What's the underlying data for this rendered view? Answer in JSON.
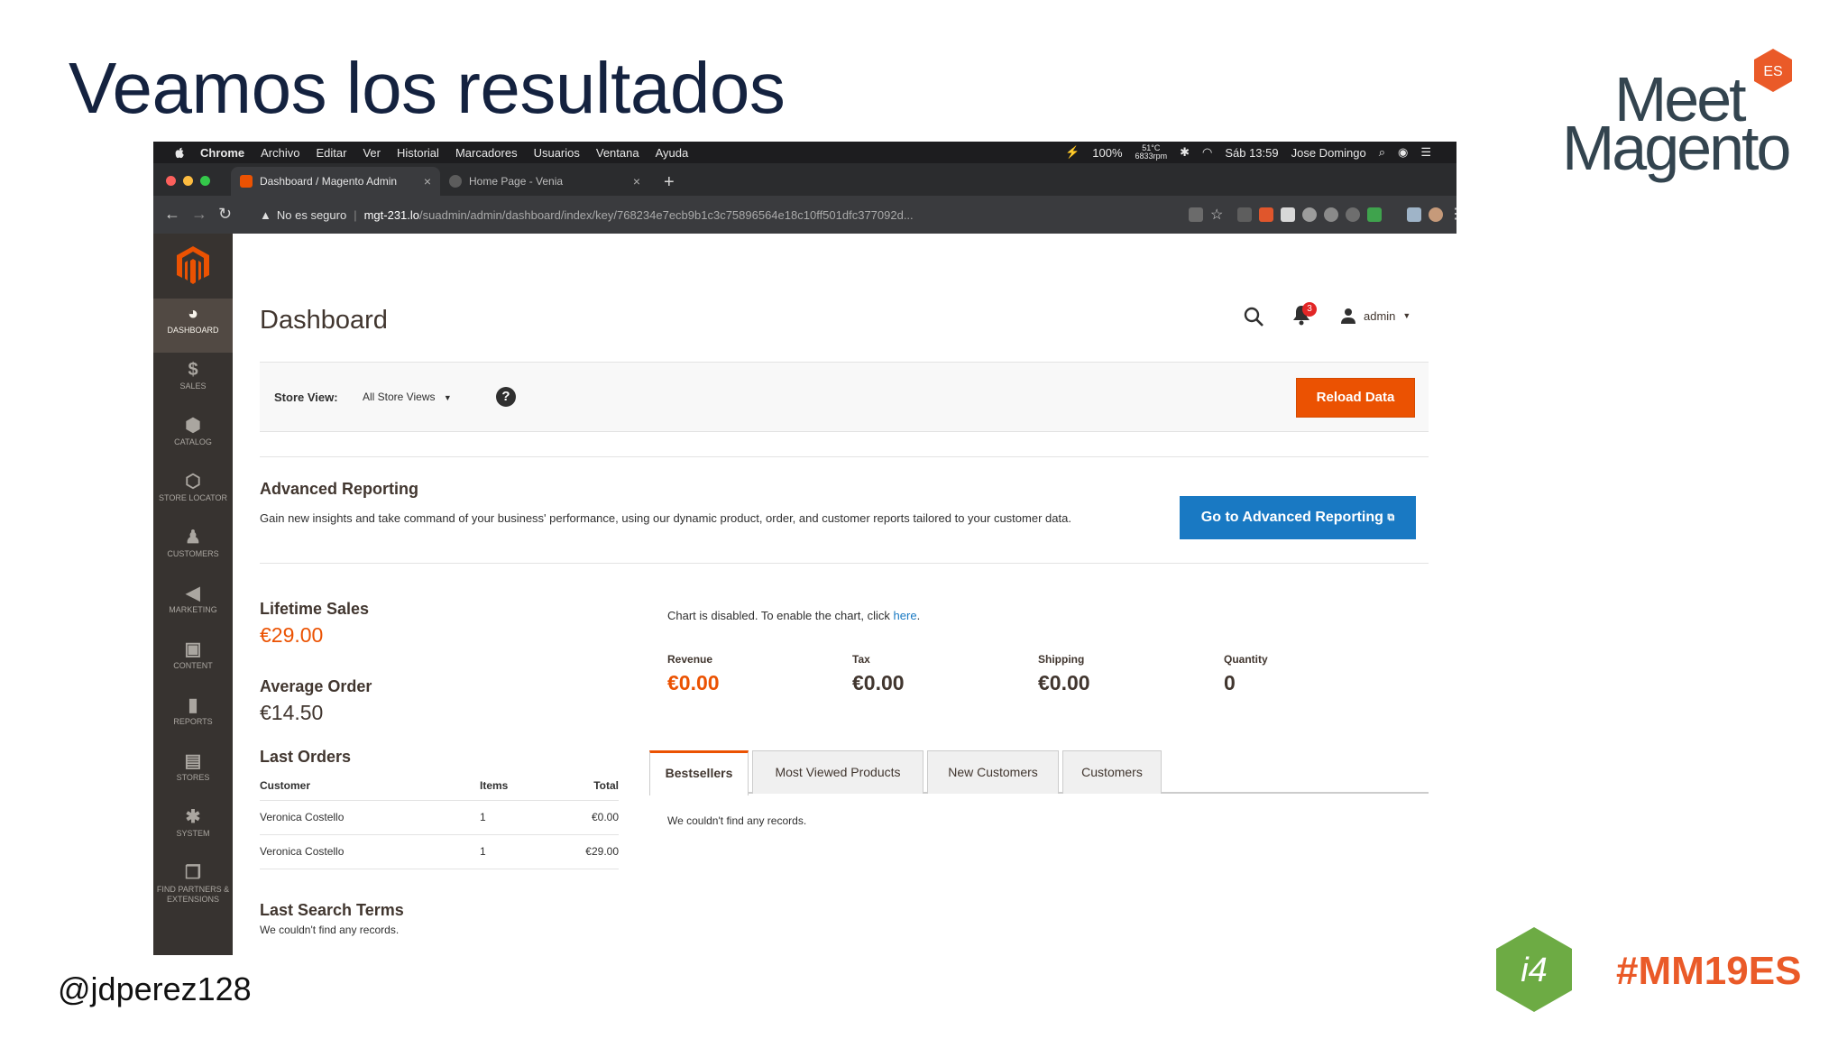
{
  "slide": {
    "title": "Veamos los resultados",
    "handle": "@jdperez128",
    "hashtag": "#MM19ES",
    "logo": {
      "word1": "Meet",
      "word2": "Magento",
      "badge": "ES"
    },
    "colors": {
      "title": "#14223f",
      "hashtag": "#ea5a28",
      "i4_green": "#6dab44"
    }
  },
  "macos_menubar": {
    "app": "Chrome",
    "menus": [
      "Archivo",
      "Editar",
      "Ver",
      "Historial",
      "Marcadores",
      "Usuarios",
      "Ventana",
      "Ayuda"
    ],
    "battery": "100%",
    "temp": "51°C",
    "fan": "6833rpm",
    "clock": "Sáb 13:59",
    "user": "Jose Domingo"
  },
  "browser": {
    "tabs": [
      {
        "label": "Dashboard / Magento Admin",
        "active": true
      },
      {
        "label": "Home Page - Venia",
        "active": false
      }
    ],
    "security": "No es seguro",
    "url_host": "mgt-231.lo",
    "url_path": "/suadmin/admin/dashboard/index/key/768234e7ecb9b1c3c75896564e18c10ff501dfc377092d..."
  },
  "sidebar": {
    "items": [
      {
        "label": "Dashboard",
        "icon": "dashboard-icon",
        "glyph": "◕"
      },
      {
        "label": "Sales",
        "icon": "dollar-icon",
        "glyph": "$"
      },
      {
        "label": "Catalog",
        "icon": "box-icon",
        "glyph": "⬢"
      },
      {
        "label": "Store Locator",
        "icon": "hexagon-icon",
        "glyph": "⬡"
      },
      {
        "label": "Customers",
        "icon": "person-icon",
        "glyph": "♟"
      },
      {
        "label": "Marketing",
        "icon": "megaphone-icon",
        "glyph": "◀"
      },
      {
        "label": "Content",
        "icon": "content-icon",
        "glyph": "▣"
      },
      {
        "label": "Reports",
        "icon": "bar-chart-icon",
        "glyph": "▮"
      },
      {
        "label": "Stores",
        "icon": "store-icon",
        "glyph": "▤"
      },
      {
        "label": "System",
        "icon": "gear-icon",
        "glyph": "✱"
      },
      {
        "label": "Find Partners & Extensions",
        "icon": "cubes-icon",
        "glyph": "❒"
      }
    ]
  },
  "header": {
    "title": "Dashboard",
    "notifications": "3",
    "user": "admin"
  },
  "store_switcher": {
    "label": "Store View:",
    "value": "All Store Views",
    "help": "?",
    "reload": "Reload Data"
  },
  "advanced_reporting": {
    "title": "Advanced Reporting",
    "text": "Gain new insights and take command of your business' performance, using our dynamic product, order, and customer reports tailored to your customer data.",
    "button": "Go to Advanced Reporting"
  },
  "lifetime_sales": {
    "label": "Lifetime Sales",
    "value": "€29.00"
  },
  "average_order": {
    "label": "Average Order",
    "value": "€14.50"
  },
  "last_orders": {
    "title": "Last Orders",
    "columns": [
      "Customer",
      "Items",
      "Total"
    ],
    "rows": [
      {
        "customer": "Veronica Costello",
        "items": "1",
        "total": "€0.00"
      },
      {
        "customer": "Veronica Costello",
        "items": "1",
        "total": "€29.00"
      }
    ]
  },
  "last_search_terms": {
    "title": "Last Search Terms",
    "empty": "We couldn't find any records."
  },
  "chart": {
    "note": "Chart is disabled. To enable the chart, click",
    "link": "here",
    "period": "."
  },
  "totals": [
    {
      "label": "Revenue",
      "value": "€0.00"
    },
    {
      "label": "Tax",
      "value": "€0.00"
    },
    {
      "label": "Shipping",
      "value": "€0.00"
    },
    {
      "label": "Quantity",
      "value": "0"
    }
  ],
  "grid_tabs": {
    "tabs": [
      "Bestsellers",
      "Most Viewed Products",
      "New Customers",
      "Customers"
    ],
    "empty": "We couldn't find any records."
  },
  "theme": {
    "accent": "#eb5202",
    "primary_button": "#1979c3",
    "sidebar": "#373330"
  }
}
